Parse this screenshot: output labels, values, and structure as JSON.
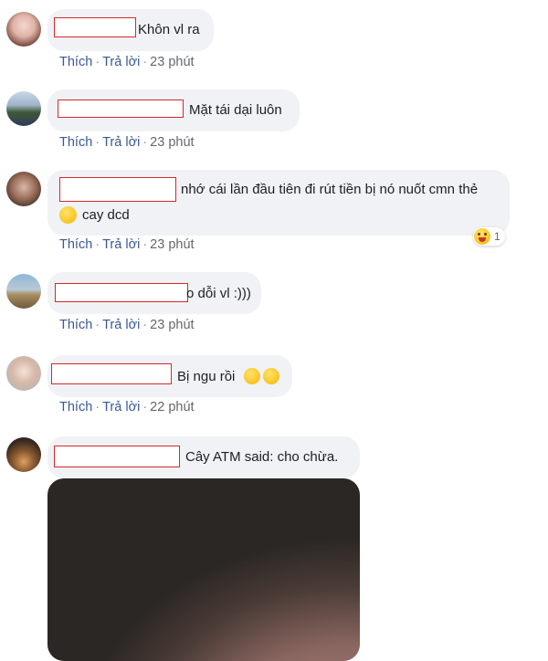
{
  "colors": {
    "bubble": "#f0f2f5",
    "action_link": "#385898",
    "meta_text": "#65676b",
    "redaction_border": "#d62828"
  },
  "labels": {
    "like": "Thích",
    "reply": "Trả lời",
    "separator": "·"
  },
  "comments": [
    {
      "text": "Khôn vl ra",
      "time": "23 phút"
    },
    {
      "text": "Mặt tái dại luôn",
      "time": "23 phút"
    },
    {
      "text_line1": "nhớ cái lần đầu tiên đi rút tiền bị nó nuốt cmn thẻ",
      "text_line2": "cay dcd",
      "time": "23 phút",
      "reaction_count": "1"
    },
    {
      "text": "o dỗi vl :)))",
      "time": "23 phút"
    },
    {
      "text": "Bị ngu rồi",
      "time": "22 phút"
    },
    {
      "text": "Cây ATM said: cho chừa."
    }
  ]
}
